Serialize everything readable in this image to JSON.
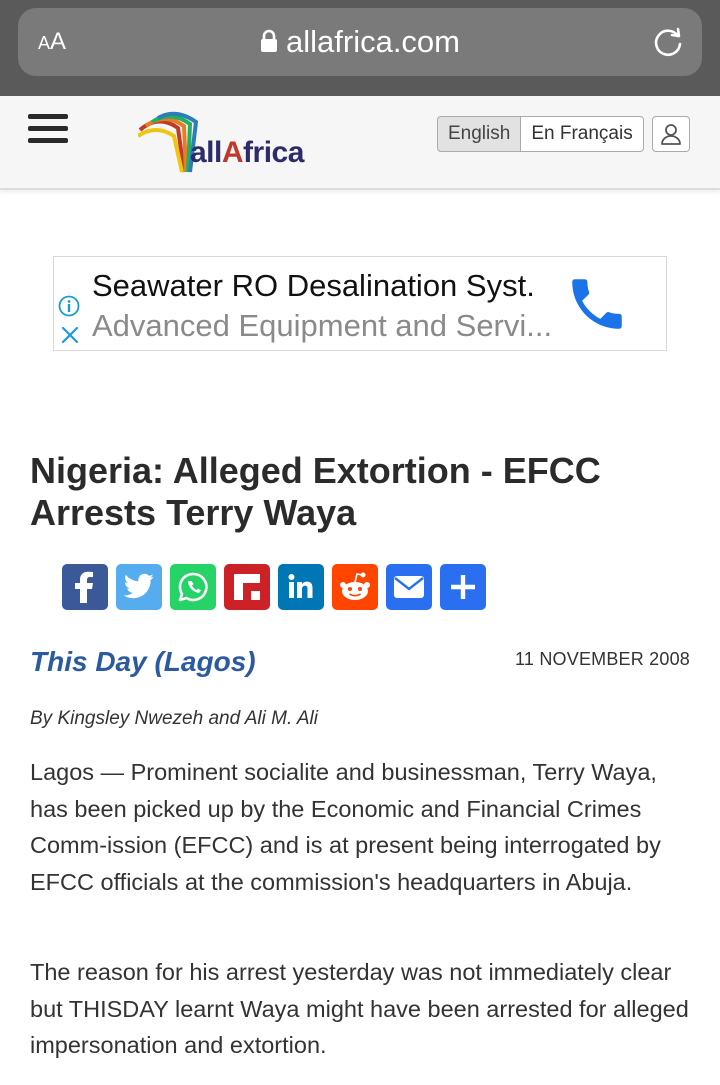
{
  "browser": {
    "text_size_label_small": "A",
    "text_size_label_large": "A",
    "url": "allafrica.com"
  },
  "site": {
    "logo_prefix": "all",
    "logo_highlight": "A",
    "logo_suffix": "frica",
    "languages": [
      "English",
      "En Français"
    ],
    "active_language": "English"
  },
  "ad": {
    "title": "Seawater RO Desalination Syst.",
    "subtitle": "Advanced Equipment and Servi..."
  },
  "article": {
    "headline": "Nigeria: Alleged Extortion - EFCC Arrests Terry Waya",
    "share_buttons": [
      "facebook",
      "twitter",
      "whatsapp",
      "flipboard",
      "linkedin",
      "reddit",
      "email",
      "more"
    ],
    "source": "This Day (Lagos)",
    "date": "11 NOVEMBER 2008",
    "byline": "By Kingsley Nwezeh and Ali M. Ali",
    "paragraphs": [
      "Lagos — Prominent socialite and businessman, Terry Waya, has been picked up by the Economic and Financial Crimes Comm-ission (EFCC) and is at present being interrogated by EFCC officials at the commission's headquarters in Abuja.",
      "The reason for his arrest yesterday was not immediately clear but THISDAY learnt Waya might have been arrested for alleged impersonation and extortion."
    ]
  },
  "colors": {
    "source_link": "#2c5aa0",
    "facebook": "#3b5998",
    "twitter": "#55acee",
    "whatsapp": "#25d366",
    "flipboard": "#cc2127",
    "linkedin": "#0077b5",
    "reddit": "#ff4500",
    "email": "#2a6ff0",
    "more": "#2a6ff0",
    "ad_phone": "#1a73e8"
  }
}
